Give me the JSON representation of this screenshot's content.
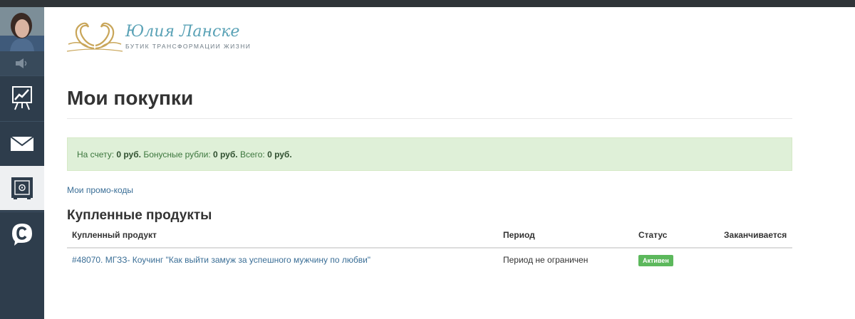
{
  "logo": {
    "title": "Юлия Ланске",
    "subtitle": "БУТИК ТРАНСФОРМАЦИИ ЖИЗНИ"
  },
  "sidebar": {
    "items": [
      {
        "name": "stats",
        "icon": "chart-board-icon",
        "active": false
      },
      {
        "name": "messages",
        "icon": "envelope-icon",
        "active": false
      },
      {
        "name": "purchases",
        "icon": "safe-icon",
        "active": true
      },
      {
        "name": "chat",
        "icon": "chat-c-icon",
        "active": false
      }
    ]
  },
  "page": {
    "title": "Мои покупки"
  },
  "balance": {
    "account_label": "На счету: ",
    "account_value": "0 руб.",
    "bonus_label": " Бонусные рубли: ",
    "bonus_value": "0 руб.",
    "total_label": " Всего: ",
    "total_value": "0 руб."
  },
  "promo_link": "Мои промо-коды",
  "purchased": {
    "section_title": "Купленные продукты",
    "columns": [
      "Купленный продукт",
      "Период",
      "Статус",
      "Заканчивается"
    ],
    "rows": [
      {
        "product": "#48070. МГЗЗ- Коучинг \"Как выйти замуж за успешного мужчину по любви\"",
        "period": "Период не ограничен",
        "status": "Активен",
        "ends": ""
      }
    ]
  },
  "colors": {
    "sidebar_bg": "#2e3d4c",
    "link": "#3a6e96",
    "success_bg": "#dff0d8",
    "badge": "#5cb85c",
    "logo_text": "#5aa2b6",
    "logo_gold": "#c9a65a"
  }
}
